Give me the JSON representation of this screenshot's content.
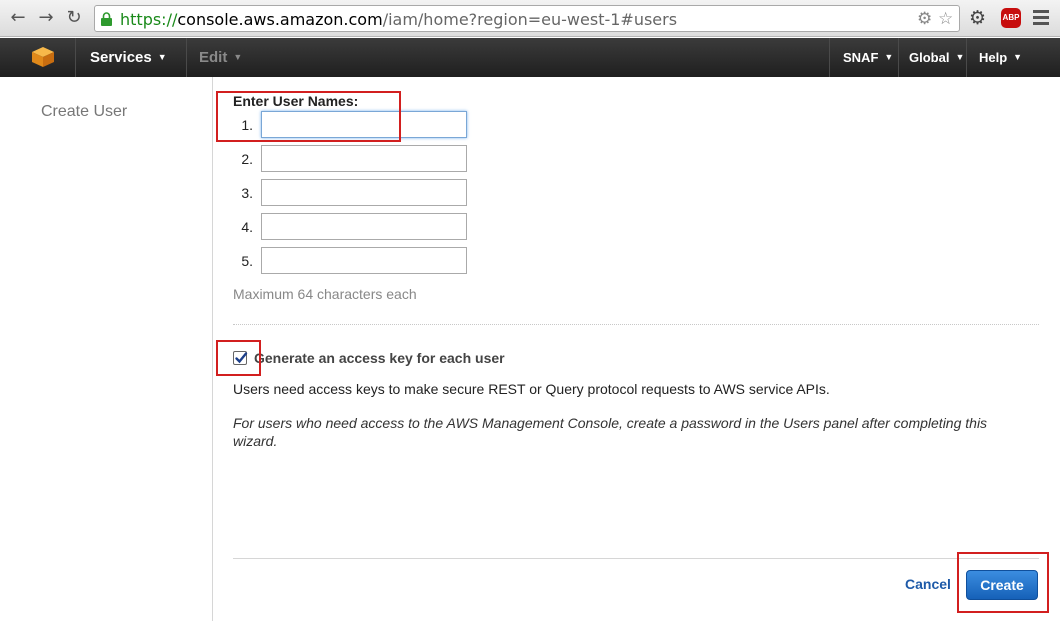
{
  "browser": {
    "url_https": "https://",
    "url_host": "console.aws.amazon.com",
    "url_path": "/iam/home?region=eu-west-1#users",
    "adblock_label": "ABP"
  },
  "header": {
    "services_label": "Services",
    "edit_label": "Edit",
    "account_label": "SNAF",
    "region_label": "Global",
    "help_label": "Help"
  },
  "sidebar": {
    "title": "Create User"
  },
  "form": {
    "heading": "Enter User Names:",
    "rows": [
      {
        "num": "1.",
        "value": "",
        "focused": true
      },
      {
        "num": "2.",
        "value": ""
      },
      {
        "num": "3.",
        "value": ""
      },
      {
        "num": "4.",
        "value": ""
      },
      {
        "num": "5.",
        "value": ""
      }
    ],
    "hint": "Maximum 64 characters each",
    "access_key_label": "Generate an access key for each user",
    "access_key_checked": true,
    "info": "Users need access keys to make secure REST or Query protocol requests to AWS service APIs.",
    "info_italic": "For users who need access to the AWS Management Console, create a password in the Users panel after completing this wizard."
  },
  "actions": {
    "cancel_label": "Cancel",
    "create_label": "Create"
  },
  "colors": {
    "highlight": "#d21f1f",
    "primary_button": "#1f6fc8",
    "link": "#1e5aa8",
    "aws_orange": "#f4a523"
  }
}
